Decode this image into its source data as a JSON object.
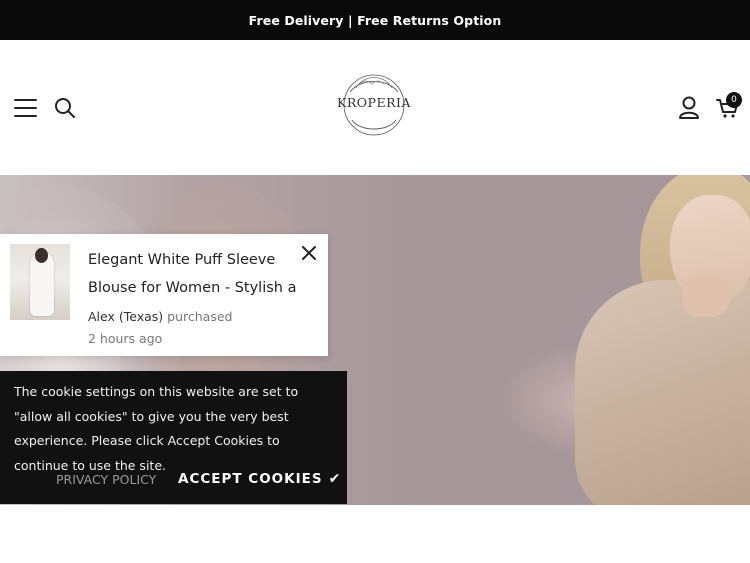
{
  "announcement": {
    "text": "Free Delivery | Free Returns Option"
  },
  "header": {
    "logo_text": "KROPERIA",
    "cart_count": "0",
    "icons": {
      "menu": "hamburger-icon",
      "search": "search-icon",
      "account": "user-icon",
      "cart": "cart-icon"
    }
  },
  "sales_popup": {
    "product_title_line1": "Elegant White Puff Sleeve",
    "product_title_line2": "Blouse for Women - Stylish a...",
    "buyer": "Alex (Texas)",
    "action": "purchased",
    "time_ago": "2 hours ago"
  },
  "cookie_banner": {
    "message": "The cookie settings on this website are set to \"allow all cookies\" to give you the very best experience. Please click Accept Cookies to continue to use the site.",
    "privacy_label": "PRIVACY POLICY",
    "accept_label": "ACCEPT COOKIES",
    "accept_check": "✔"
  },
  "colors": {
    "announcement_bg": "#0a0a0a",
    "hero_bg": "#a8979a",
    "cookie_bg": "#111111"
  }
}
